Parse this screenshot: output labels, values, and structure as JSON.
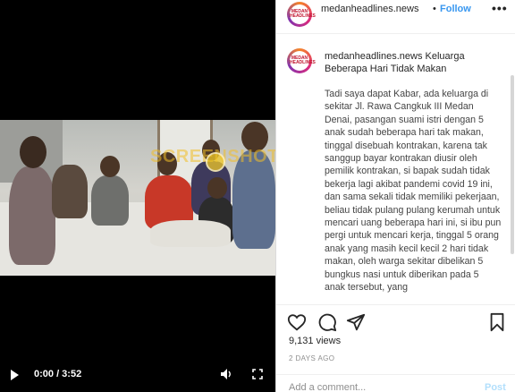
{
  "video": {
    "watermark": "SCREENSHOT BY",
    "time": "0:00 / 3:52"
  },
  "header": {
    "avatar_text": "MEDAN HEADLINES",
    "username": "medanheadlines.news",
    "separator": "•",
    "follow_label": "Follow",
    "more_label": "•••"
  },
  "caption": {
    "username": "medanheadlines.news",
    "title": "Keluarga Beberapa Hari Tidak Makan",
    "body": "Tadi saya dapat Kabar, ada keluarga di sekitar Jl. Rawa Cangkuk III Medan Denai, pasangan suami istri dengan 5 anak sudah beberapa hari tak makan, tinggal disebuah kontrakan, karena tak sanggup bayar kontrakan diusir oleh pemilik kontrakan, si bapak sudah tidak bekerja lagi akibat pandemi covid 19 ini, dan sama sekali tidak memiliki pekerjaan, beliau tidak pulang pulang kerumah untuk mencari uang beberapa hari ini, si ibu pun pergi untuk mencari kerja, tinggal 5 orang anak yang masih kecil kecil 2 hari tidak makan, oleh warga sekitar dibelikan 5 bungkus nasi untuk diberikan pada 5 anak tersebut, yang"
  },
  "actions": {
    "icons": [
      "heart-icon",
      "comment-icon",
      "share-icon",
      "bookmark-icon"
    ]
  },
  "stats": {
    "views": "9,131 views",
    "date": "2 DAYS AGO"
  },
  "comment": {
    "placeholder": "Add a comment...",
    "post_label": "Post"
  },
  "colors": {
    "follow": "#3897f0",
    "post_disabled": "#b2dffc",
    "watermark": "#f0be28"
  }
}
